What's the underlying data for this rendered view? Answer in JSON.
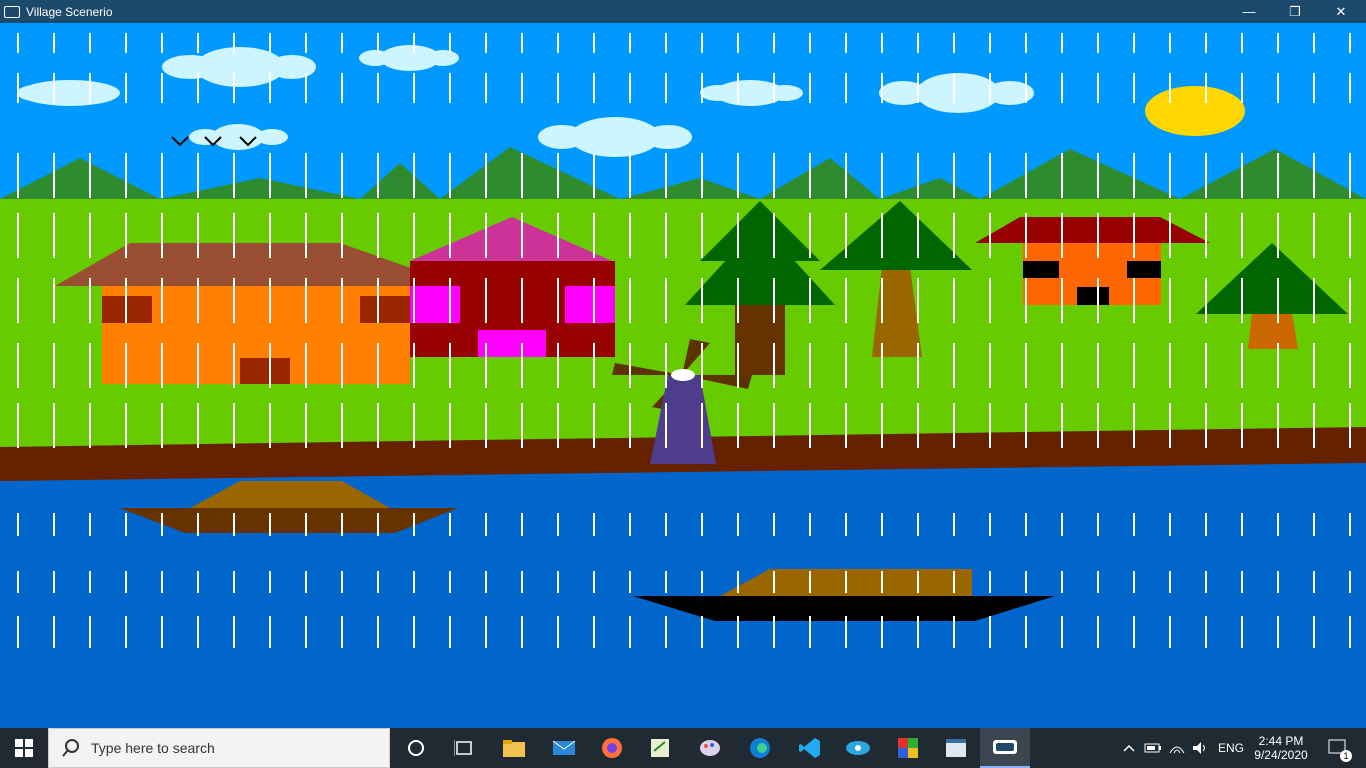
{
  "window": {
    "title": "Village Scenerio",
    "minimize_label": "—",
    "restore_label": "❐",
    "close_label": "✕"
  },
  "scene": {
    "sky_color": "#0099ff",
    "grass_color": "#66cc00",
    "river_color": "#0066cc",
    "bank_color": "#662200",
    "mountain_color": "#2e8b2e",
    "sun_color": "#ffd700",
    "cloud_color": "#ccf5ff",
    "rain_color": "#ffffff"
  },
  "taskbar": {
    "start_icon": "windows-logo-icon",
    "search_placeholder": "Type here to search",
    "pinned_apps": [
      {
        "name": "cortana-icon"
      },
      {
        "name": "task-view-icon"
      },
      {
        "name": "file-explorer-icon"
      },
      {
        "name": "mail-icon"
      },
      {
        "name": "firefox-icon"
      },
      {
        "name": "notepad-icon"
      },
      {
        "name": "paint-icon"
      },
      {
        "name": "edge-icon"
      },
      {
        "name": "vscode-icon"
      },
      {
        "name": "eye-app-icon"
      },
      {
        "name": "office-icon"
      },
      {
        "name": "window-app-icon"
      },
      {
        "name": "village-scenerio-app-icon"
      }
    ],
    "tray": {
      "language": "ENG",
      "time": "2:44 PM",
      "date": "9/24/2020",
      "notification_count": "1"
    }
  }
}
